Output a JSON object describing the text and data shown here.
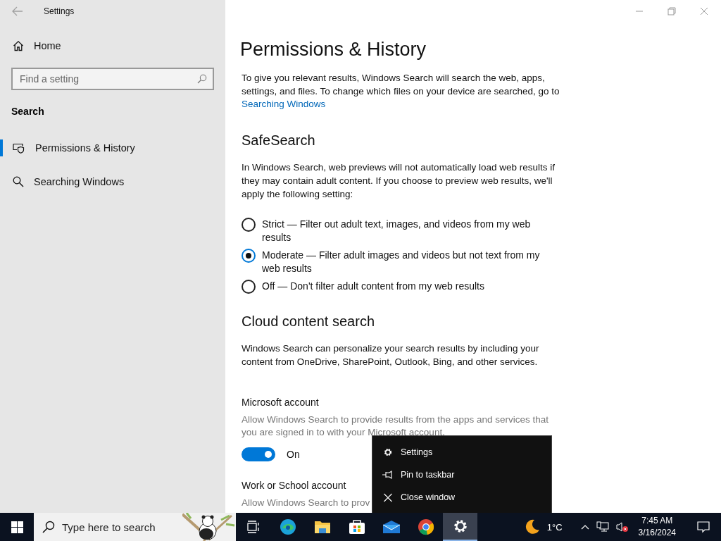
{
  "window": {
    "title": "Settings"
  },
  "sidebar": {
    "home": "Home",
    "search": {
      "placeholder": "Find a setting"
    },
    "section": "Search",
    "items": [
      {
        "label": "Permissions & History",
        "kind": "shield",
        "selected": true
      },
      {
        "label": "Searching Windows",
        "kind": "search",
        "selected": false
      }
    ]
  },
  "main": {
    "title": "Permissions & History",
    "intro": {
      "text": "To give you relevant results, Windows Search will search the web, apps, settings, and files. To change which files on your device are searched, go to",
      "link": "Searching Windows"
    },
    "safesearch": {
      "heading": "SafeSearch",
      "description": "In Windows Search, web previews will not automatically load web results if they may contain adult content. If you choose to preview web results, we'll apply the following setting:",
      "options": [
        {
          "label": "Strict — Filter out adult text, images, and videos from my web results",
          "selected": false
        },
        {
          "label": "Moderate — Filter adult images and videos but not text from my web results",
          "selected": true
        },
        {
          "label": "Off — Don't filter adult content from my web results",
          "selected": false
        }
      ]
    },
    "cloud": {
      "heading": "Cloud content search",
      "description": "Windows Search can personalize your search results by including your content from OneDrive, SharePoint, Outlook, Bing, and other services.",
      "accounts": [
        {
          "title": "Microsoft account",
          "description": "Allow Windows Search to provide results from the apps and services that you are signed in to with your Microsoft account.",
          "toggle": {
            "on": true,
            "label": "On"
          }
        },
        {
          "title": "Work or School account",
          "description": "Allow Windows Search to prov"
        }
      ]
    }
  },
  "context_menu": {
    "items": [
      {
        "label": "Settings",
        "kind": "gear"
      },
      {
        "label": "Pin to taskbar",
        "kind": "pin"
      },
      {
        "label": "Close window",
        "kind": "close"
      }
    ]
  },
  "taskbar": {
    "search": {
      "placeholder": "Type here to search"
    },
    "apps": [
      {
        "kind": "taskview",
        "selected": false
      },
      {
        "kind": "edge",
        "selected": false
      },
      {
        "kind": "explorer",
        "selected": false
      },
      {
        "kind": "store",
        "selected": false
      },
      {
        "kind": "mail",
        "selected": false
      },
      {
        "kind": "chrome",
        "selected": false
      },
      {
        "kind": "settings",
        "selected": true
      }
    ],
    "weather": "1°C",
    "time": "7:45 AM",
    "date": "3/16/2024"
  }
}
